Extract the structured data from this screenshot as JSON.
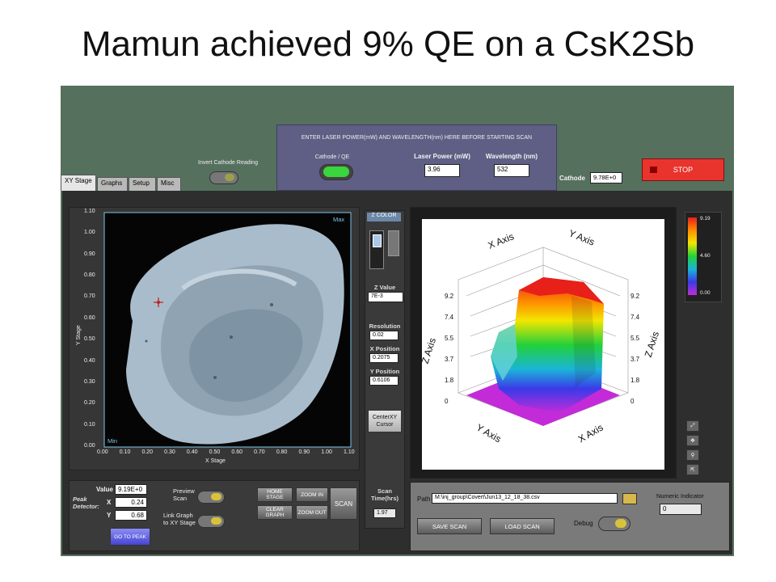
{
  "slide_title": "Mamun achieved 9% QE on a CsK2Sb",
  "top": {
    "invert_label": "Invert Cathode Reading",
    "panel_instruction": "ENTER LASER POWER(mW)  AND WAVELENGTH(nm) HERE BEFORE STARTING SCAN",
    "cathode_qe_label": "Cathode  /  QE",
    "laser_power_label": "Laser Power (mW)",
    "laser_power_value": "3.96",
    "wavelength_label": "Wavelength (nm)",
    "wavelength_value": "532",
    "cathode_label": "Cathode",
    "cathode_value": "9.78E+0",
    "stop_label": "STOP"
  },
  "tabs": [
    {
      "label": "XY Stage",
      "active": true
    },
    {
      "label": "Graphs",
      "active": false
    },
    {
      "label": "Setup",
      "active": false
    },
    {
      "label": "Misc",
      "active": false
    }
  ],
  "xy_plot": {
    "x_label": "X Stage",
    "y_label": "Y Stage",
    "max_label": "Max",
    "min_label": "Min",
    "x_ticks": [
      "0.00",
      "0.10",
      "0.20",
      "0.30",
      "0.40",
      "0.50",
      "0.60",
      "0.70",
      "0.80",
      "0.90",
      "1.00",
      "1.10"
    ],
    "y_ticks": [
      "1.10",
      "1.00",
      "0.90",
      "0.80",
      "0.70",
      "0.60",
      "0.50",
      "0.40",
      "0.30",
      "0.20",
      "0.10",
      "0.00"
    ]
  },
  "side": {
    "zcolor_label": "Z COLOR",
    "z_value_label": "Z Value",
    "z_value": "7E-3",
    "resolution_label": "Resolution",
    "resolution_value": "0.02",
    "x_position_label": "X Position",
    "x_position_value": "0.2075",
    "y_position_label": "Y Position",
    "y_position_value": "0.6106",
    "center_btn": "CenterXY\nCursor",
    "scan_time_label": "Scan\nTime(hrs)",
    "scan_time_value": "1.97"
  },
  "surface": {
    "x_axis": "X Axis",
    "y_axis": "Y Axis",
    "z_axis": "Z Axis",
    "z_ticks": [
      "9.2",
      "7.4",
      "5.5",
      "3.7",
      "1.8",
      "0"
    ],
    "scale_ticks": [
      "9.19",
      "4.60",
      "0.00"
    ]
  },
  "bottom": {
    "peak_detector_label": "Peak\nDetector:",
    "value_label": "Value",
    "value_value": "9.19E+0",
    "x_label": "X",
    "x_value": "0.24",
    "y_label": "Y",
    "y_value": "0.68",
    "go_to_peak": "GO TO PEAK",
    "preview_scan": "Preview\nScan",
    "link_graph": "Link Graph\nto XY Stage",
    "home_stage": "HOME STAGE",
    "zoom_in": "ZOOM IN",
    "clear_graph": "CLEAR GRAPH",
    "zoom_out": "ZOOM OUT",
    "scan": "SCAN",
    "path_label": "Path",
    "path_value": "M:\\inj_group\\Covert\\Jun13_12_18_38.csv",
    "save_scan": "SAVE SCAN",
    "load_scan": "LOAD SCAN",
    "debug_label": "Debug",
    "numeric_indicator_label": "Numeric Indicator",
    "numeric_indicator_value": "0"
  }
}
